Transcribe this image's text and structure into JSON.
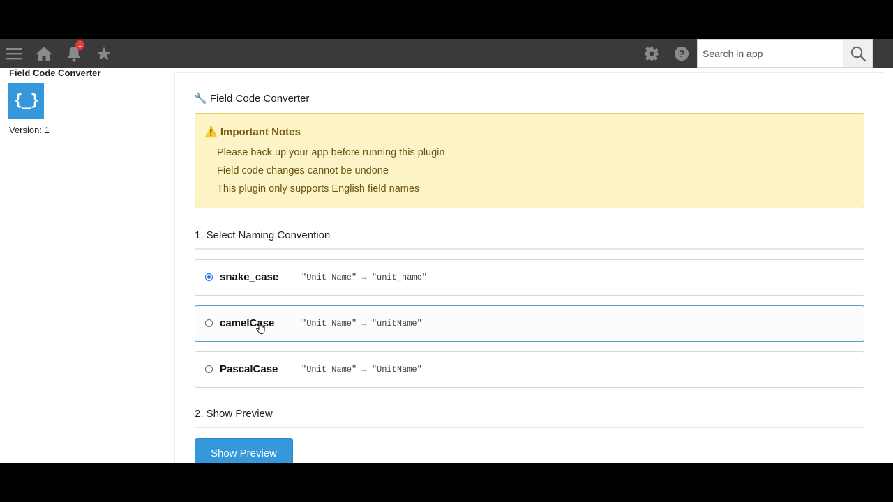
{
  "topbar": {
    "notification_count": "1",
    "search_placeholder": "Search in app"
  },
  "sidebar": {
    "title": "Field Code Converter",
    "icon_text": "{_}",
    "version": "Version: 1"
  },
  "main": {
    "title": "🔧 Field Code Converter",
    "notes": {
      "title": "⚠️ Important Notes",
      "items": [
        "Please back up your app before running this plugin",
        "Field code changes cannot be undone",
        "This plugin only supports English field names"
      ]
    },
    "section1": {
      "heading": "1. Select Naming Convention",
      "options": [
        {
          "label": "snake_case",
          "example": "\"Unit Name\" → \"unit_name\"",
          "selected": true
        },
        {
          "label": "camelCase",
          "example": "\"Unit Name\" → \"unitName\"",
          "selected": false
        },
        {
          "label": "PascalCase",
          "example": "\"Unit Name\" → \"UnitName\"",
          "selected": false
        }
      ]
    },
    "section2": {
      "heading": "2. Show Preview",
      "button_label": "Show Preview"
    }
  },
  "colors": {
    "topbar": "#3a3a3a",
    "accent": "#3498db",
    "notes_bg": "#fcf4c7",
    "notes_border": "#e7cf60",
    "radio_selected": "#1a73e8"
  }
}
